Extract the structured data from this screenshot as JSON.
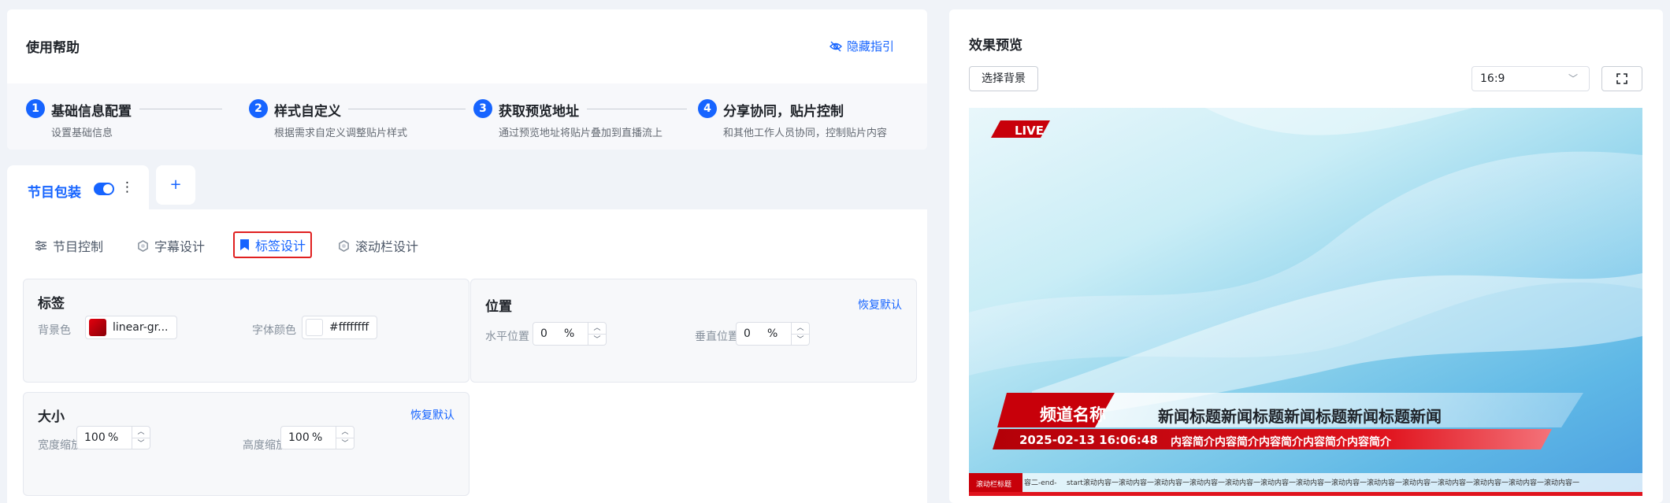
{
  "help": {
    "title": "使用帮助",
    "hide_guide": "隐藏指引",
    "steps": [
      {
        "num": "1",
        "title": "基础信息配置",
        "desc": "设置基础信息"
      },
      {
        "num": "2",
        "title": "样式自定义",
        "desc": "根据需求自定义调整贴片样式"
      },
      {
        "num": "3",
        "title": "获取预览地址",
        "desc": "通过预览地址将贴片叠加到直播流上"
      },
      {
        "num": "4",
        "title": "分享协同，贴片控制",
        "desc": "和其他工作人员协同，控制贴片内容"
      }
    ]
  },
  "tabs": {
    "program": "节目包装",
    "program_enabled": true,
    "more": "⋮",
    "add": "+"
  },
  "subtabs": [
    {
      "label": "节目控制",
      "icon": "sliders-icon",
      "active": false
    },
    {
      "label": "字幕设计",
      "icon": "hexagon-icon",
      "active": false
    },
    {
      "label": "标签设计",
      "icon": "bookmark-icon",
      "active": true
    },
    {
      "label": "滚动栏设计",
      "icon": "hexagon-icon",
      "active": false
    }
  ],
  "label_panel": {
    "title": "标签",
    "bg_label": "背景色",
    "bg_value": "linear-gr...",
    "bg_color": "#c00000",
    "font_color_label": "字体颜色",
    "font_color_value": "#ffffffff",
    "font_color": "#ffffff"
  },
  "position_panel": {
    "title": "位置",
    "restore": "恢复默认",
    "h_label": "水平位置",
    "h_value": "0",
    "v_label": "垂直位置",
    "v_value": "0",
    "unit": "%"
  },
  "size_panel": {
    "title": "大小",
    "restore": "恢复默认",
    "w_label": "宽度缩放",
    "w_value": "100",
    "h_label": "高度缩放",
    "h_value": "100",
    "unit": "%"
  },
  "preview": {
    "title": "效果预览",
    "select_bg": "选择背景",
    "ratio": "16:9",
    "live": "LIVE",
    "channel": "频道名称",
    "headline": "新闻标题新闻标题新闻标题新闻标题新闻",
    "datetime": "2025-02-13 16:06:48",
    "summary": "内容简介内容简介内容简介内容简介内容简介",
    "ticker_label": "滚动栏标题",
    "ticker_prefix": "容二-end-",
    "ticker_text": "start滚动内容一滚动内容一滚动内容一滚动内容一滚动内容一滚动内容一滚动内容一滚动内容一滚动内容一滚动内容一滚动内容一滚动内容一滚动内容一滚动内容一",
    "accent": "#1664ff",
    "brand_red": "#c8000a"
  }
}
